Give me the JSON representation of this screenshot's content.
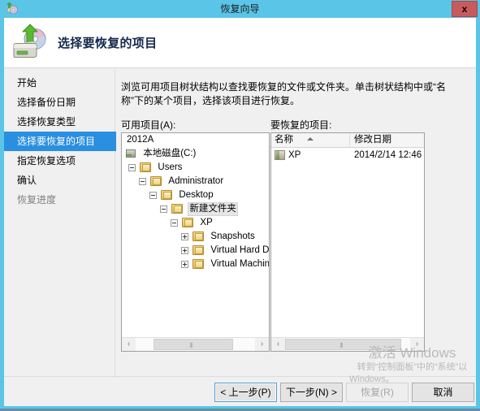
{
  "window": {
    "title": "恢复向导",
    "close_label": "x",
    "title_icon": "recovery-wizard-icon",
    "accent_color": "#5bc5e8",
    "selection_color": "#2a8fe0",
    "close_button_color": "#c75b5b"
  },
  "banner": {
    "heading": "选择要恢复的项目",
    "icon": "disk-restore-icon"
  },
  "sidebar": {
    "items": [
      {
        "label": "开始",
        "state": "normal"
      },
      {
        "label": "选择备份日期",
        "state": "normal"
      },
      {
        "label": "选择恢复类型",
        "state": "normal"
      },
      {
        "label": "选择要恢复的项目",
        "state": "selected"
      },
      {
        "label": "指定恢复选项",
        "state": "normal"
      },
      {
        "label": "确认",
        "state": "normal"
      },
      {
        "label": "恢复进度",
        "state": "disabled"
      }
    ]
  },
  "content": {
    "instructions": "浏览可用项目树状结构以查找要恢复的文件或文件夹。单击树状结构中或“名称”下的某个项目，选择该项目进行恢复。",
    "available_items_label": "可用项目(A):",
    "items_to_recover_label": "要恢复的项目:"
  },
  "tree": {
    "nodes": [
      {
        "label": "2012A",
        "depth": 0,
        "expander": "none",
        "icon": "none",
        "selected": false
      },
      {
        "label": "本地磁盘(C:)",
        "depth": 0,
        "expander": "none",
        "icon": "drive",
        "selected": false
      },
      {
        "label": "Users",
        "depth": 1,
        "expander": "minus",
        "icon": "folder",
        "selected": false
      },
      {
        "label": "Administrator",
        "depth": 2,
        "expander": "minus",
        "icon": "folder",
        "selected": false
      },
      {
        "label": "Desktop",
        "depth": 3,
        "expander": "minus",
        "icon": "folder",
        "selected": false
      },
      {
        "label": "新建文件夹",
        "depth": 4,
        "expander": "minus",
        "icon": "folder",
        "selected": true
      },
      {
        "label": "XP",
        "depth": 5,
        "expander": "minus",
        "icon": "folder",
        "selected": false
      },
      {
        "label": "Snapshots",
        "depth": 6,
        "expander": "plus",
        "icon": "folder",
        "selected": false
      },
      {
        "label": "Virtual Hard Di",
        "depth": 6,
        "expander": "plus",
        "icon": "folder",
        "selected": false
      },
      {
        "label": "Virtual Machine",
        "depth": 6,
        "expander": "plus",
        "icon": "folder",
        "selected": false
      }
    ]
  },
  "list": {
    "columns": [
      {
        "label": "名称",
        "sorted": "asc"
      },
      {
        "label": "修改日期",
        "sorted": "none"
      }
    ],
    "rows": [
      {
        "name": "XP",
        "modified": "2014/2/14 12:46",
        "icon": "folder-small-icon"
      }
    ]
  },
  "scrollbars": {
    "left_arrow": "‹",
    "right_arrow": "›",
    "grip": "⦀"
  },
  "footer": {
    "buttons": [
      {
        "id": "prev",
        "label": "< 上一步(P)",
        "enabled": true,
        "focused": true
      },
      {
        "id": "next",
        "label": "下一步(N) >",
        "enabled": true,
        "focused": false
      },
      {
        "id": "recover",
        "label": "恢复(R)",
        "enabled": false,
        "focused": false
      },
      {
        "id": "cancel",
        "label": "取消",
        "enabled": true,
        "focused": false
      }
    ]
  },
  "watermark": {
    "line1": "激活 Windows",
    "line2": "转到“控制面板”中的“系统”以",
    "line3": "Windows。"
  }
}
